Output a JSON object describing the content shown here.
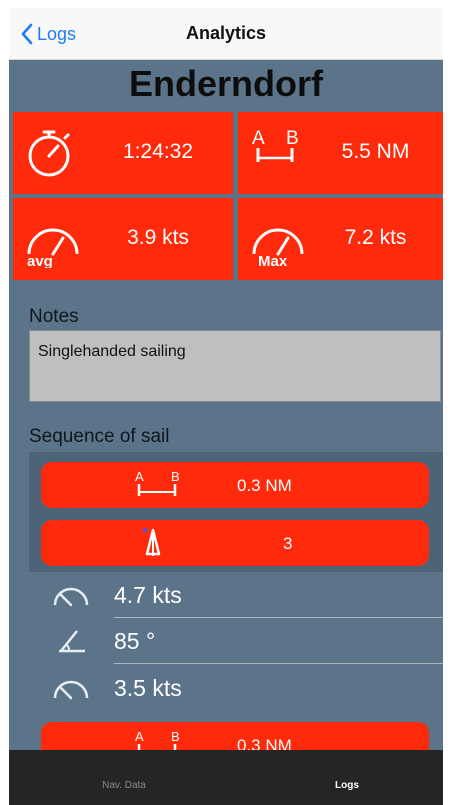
{
  "nav": {
    "back_label": "Logs",
    "title": "Analytics"
  },
  "venue": "Enderndorf",
  "summary": {
    "duration": {
      "icon": "stopwatch-icon",
      "value": "1:24:32"
    },
    "distance": {
      "icon": "distance-ab-icon",
      "value": "5.5 NM",
      "icon_text_a": "A",
      "icon_text_b": "B"
    },
    "avg_speed": {
      "icon": "avg-speed-gauge-icon",
      "value": "3.9 kts",
      "icon_text": "avg"
    },
    "max_speed": {
      "icon": "max-speed-gauge-icon",
      "value": "7.2 kts",
      "icon_text": "Max"
    }
  },
  "notes": {
    "label": "Notes",
    "text": "Singlehanded sailing"
  },
  "sequence": {
    "label": "Sequence of sail",
    "leg_distance": {
      "icon": "distance-ab-icon",
      "value": "0.3 NM"
    },
    "tack_count": {
      "icon": "sail-tack-icon",
      "value": "3"
    },
    "max_speed": {
      "icon": "speed-gauge-icon",
      "value": "4.7 kts"
    },
    "angle": {
      "icon": "wind-angle-icon",
      "value": "85 °"
    },
    "avg_speed": {
      "icon": "speed-gauge-icon",
      "value": "3.5 kts"
    },
    "next_leg_distance": {
      "icon": "distance-ab-icon",
      "value": "0.3 NM"
    }
  },
  "tabs": [
    {
      "label": "Nav. Data",
      "active": false
    },
    {
      "label": "Logs",
      "active": true
    }
  ],
  "colors": {
    "accent": "#ff2a0b",
    "background": "#5c7489",
    "link": "#1e7cf2"
  }
}
